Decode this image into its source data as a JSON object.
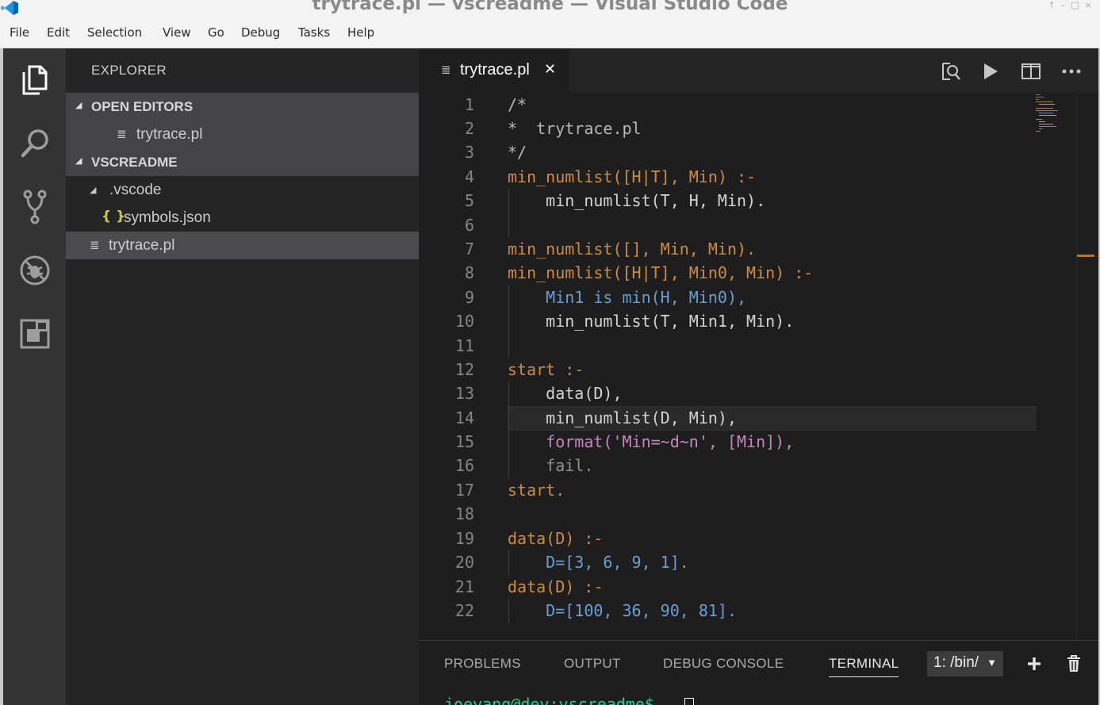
{
  "window": {
    "title": "trytrace.pl — vscreadme — Visual Studio Code",
    "controls": [
      "↑",
      "–",
      "□",
      "×"
    ]
  },
  "menu": [
    "File",
    "Edit",
    "Selection",
    "View",
    "Go",
    "Debug",
    "Tasks",
    "Help"
  ],
  "activity_bar": [
    "explorer-icon",
    "search-icon",
    "source-control-icon",
    "debug-icon",
    "extensions-icon"
  ],
  "sidebar": {
    "title": "EXPLORER",
    "open_editors_label": "OPEN EDITORS",
    "open_editors": [
      {
        "icon": "≣",
        "name": "trytrace.pl"
      }
    ],
    "project_label": "VSCREADME",
    "tree": [
      {
        "icon": "◢",
        "name": ".vscode"
      },
      {
        "icon": "{ }",
        "name": "symbols.json"
      },
      {
        "icon": "≣",
        "name": "trytrace.pl"
      }
    ]
  },
  "editor": {
    "tab": {
      "icon": "≣",
      "name": "trytrace.pl",
      "close": "✕"
    },
    "toolbar": [
      "find-references-icon",
      "run-icon",
      "split-editor-icon",
      "more-actions-icon"
    ],
    "line_numbers": [
      "1",
      "2",
      "3",
      "4",
      "5",
      "6",
      "7",
      "8",
      "9",
      "10",
      "11",
      "12",
      "13",
      "14",
      "15",
      "16",
      "17",
      "18",
      "19",
      "20",
      "21",
      "22"
    ],
    "lines": [
      "/*",
      "*  trytrace.pl",
      "*/",
      "min_numlist([H|T], Min) :-",
      "    min_numlist(T, H, Min).",
      "",
      "min_numlist([], Min, Min).",
      "min_numlist([H|T], Min0, Min) :-",
      "    Min1 is min(H, Min0),",
      "    min_numlist(T, Min1, Min).",
      "",
      "start :-",
      "    data(D),",
      "    min_numlist(D, Min),",
      "    format('Min=~d~n', [Min]),",
      "    fail.",
      "start.",
      "",
      "data(D) :-",
      "    D=[3, 6, 9, 1].",
      "data(D) :-",
      "    D=[100, 36, 90, 81]."
    ]
  },
  "panel": {
    "tabs": [
      "PROBLEMS",
      "OUTPUT",
      "DEBUG CONSOLE",
      "TERMINAL"
    ],
    "active_tab": "TERMINAL",
    "terminal_select": "1: /bin/",
    "terminal_caret": "▼",
    "prompt": "joeyang@dev:vscreadme$ "
  },
  "colors": {
    "activity_bar": "#333333",
    "sidebar": "#252526",
    "editor": "#1e1e1e",
    "keyword_fn": "#d18b3e",
    "variable": "#6a9fd6",
    "bracket": "#ffd700"
  }
}
